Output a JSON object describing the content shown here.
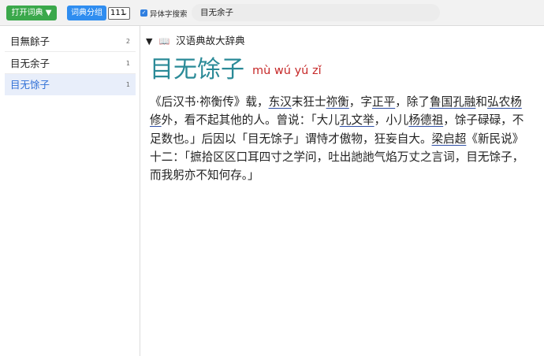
{
  "toolbar": {
    "open_dict_label": "打开词典",
    "open_dict_caret": "▼",
    "group_label": "词典分组",
    "count_select_value": "111",
    "variant_search_label": "异体字搜索",
    "variant_search_checked": true,
    "search_value": "目无余子"
  },
  "sidebar": {
    "items": [
      {
        "label": "目無餘子",
        "count": "2"
      },
      {
        "label": "目无余子",
        "count": "1"
      },
      {
        "label": "目无馀子",
        "count": "1"
      }
    ]
  },
  "entry": {
    "dictionary_name": "汉语典故大辞典",
    "headword": "目无馀子",
    "pinyin": "mù wú yú zǐ",
    "definition_segments": [
      {
        "text": "《后汉书·祢衡传》载，",
        "link": false
      },
      {
        "text": "东汉",
        "link": true
      },
      {
        "text": "末狂士",
        "link": false
      },
      {
        "text": "祢衡",
        "link": true
      },
      {
        "text": "，字",
        "link": false
      },
      {
        "text": "正平",
        "link": true
      },
      {
        "text": "，除了",
        "link": false
      },
      {
        "text": "鲁国",
        "link": true
      },
      {
        "text": "孔融",
        "link": true
      },
      {
        "text": "和",
        "link": false
      },
      {
        "text": "弘农",
        "link": true
      },
      {
        "text": "杨修",
        "link": true
      },
      {
        "text": "外，看不起其他的人。曾说：「大儿",
        "link": false
      },
      {
        "text": "孔文举",
        "link": true
      },
      {
        "text": "，小儿",
        "link": false
      },
      {
        "text": "杨德祖",
        "link": true
      },
      {
        "text": "，馀子碌碌，不足数也。」后因以「目无馀子」谓恃才傲物，狂妄自大。",
        "link": false
      },
      {
        "text": "梁启超",
        "link": true
      },
      {
        "text": "《新民说》十二：「摭拾区区口耳四寸之学问，吐出訑訑气焰万丈之言词，目无馀子，而我躬亦不知何存。」",
        "link": false
      }
    ]
  },
  "colors": {
    "open_button": "#3aa84b",
    "group_button": "#2f8df0",
    "headword": "#2a8a97",
    "pinyin": "#c62828",
    "active_item_bg": "#e8eefa",
    "active_item_text": "#2f6fd6"
  }
}
